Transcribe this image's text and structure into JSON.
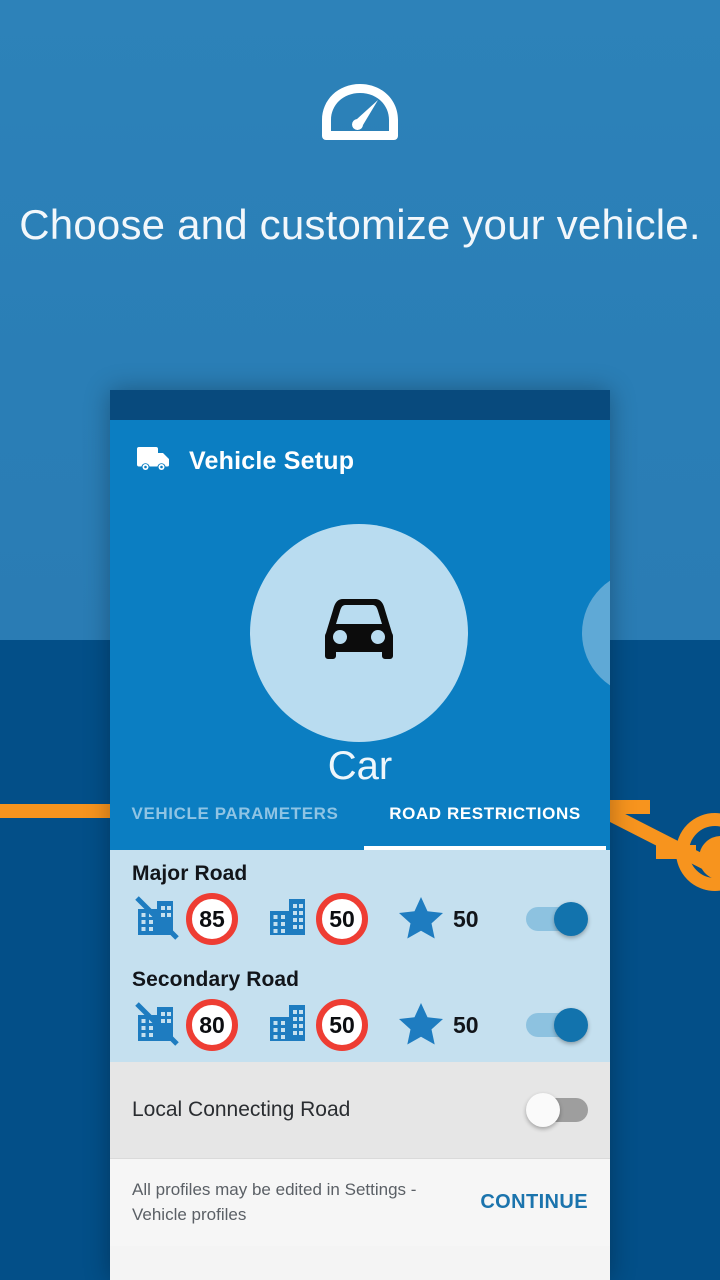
{
  "hero": {
    "icon": "speedometer-icon",
    "title": "Choose and customize your vehicle."
  },
  "card": {
    "appbar": {
      "icon": "truck-icon",
      "title": "Vehicle Setup"
    },
    "vehicle": {
      "icon": "car-icon",
      "label": "Car",
      "next_icon": "next-vehicle-partial-icon"
    },
    "tabs": [
      {
        "label": "VEHICLE PARAMETERS",
        "active": false
      },
      {
        "label": "ROAD RESTRICTIONS",
        "active": true
      }
    ],
    "roads": [
      {
        "title": "Major Road",
        "outside_city_icon": "no-buildings-icon",
        "outside_city_limit": "85",
        "in_city_icon": "buildings-icon",
        "in_city_limit": "50",
        "preference_icon": "star-icon",
        "preference_value": "50",
        "toggle_icon": "toggle-switch",
        "toggle_on": true
      },
      {
        "title": "Secondary Road",
        "outside_city_icon": "no-buildings-icon",
        "outside_city_limit": "80",
        "in_city_icon": "buildings-icon",
        "in_city_limit": "50",
        "preference_icon": "star-icon",
        "preference_value": "50",
        "toggle_icon": "toggle-switch",
        "toggle_on": true
      }
    ],
    "local_road": {
      "title": "Local Connecting Road",
      "toggle_icon": "toggle-switch",
      "toggle_on": false
    },
    "footer": {
      "note": "All profiles may be edited in Settings - Vehicle profiles",
      "cta": "CONTINUE"
    }
  },
  "colors": {
    "background_top": "#2d82b9",
    "background_map": "#034f88",
    "road_orange": "#f7941e",
    "appbar_blue": "#0b7ec2",
    "statusbar_blue": "#084a7d",
    "row_blue": "#c5e0ef",
    "sign_red": "#ee3d33",
    "accent_link": "#1b74ad",
    "toggle_on": "#1273ad",
    "toggle_off": "#9e9e9e"
  }
}
